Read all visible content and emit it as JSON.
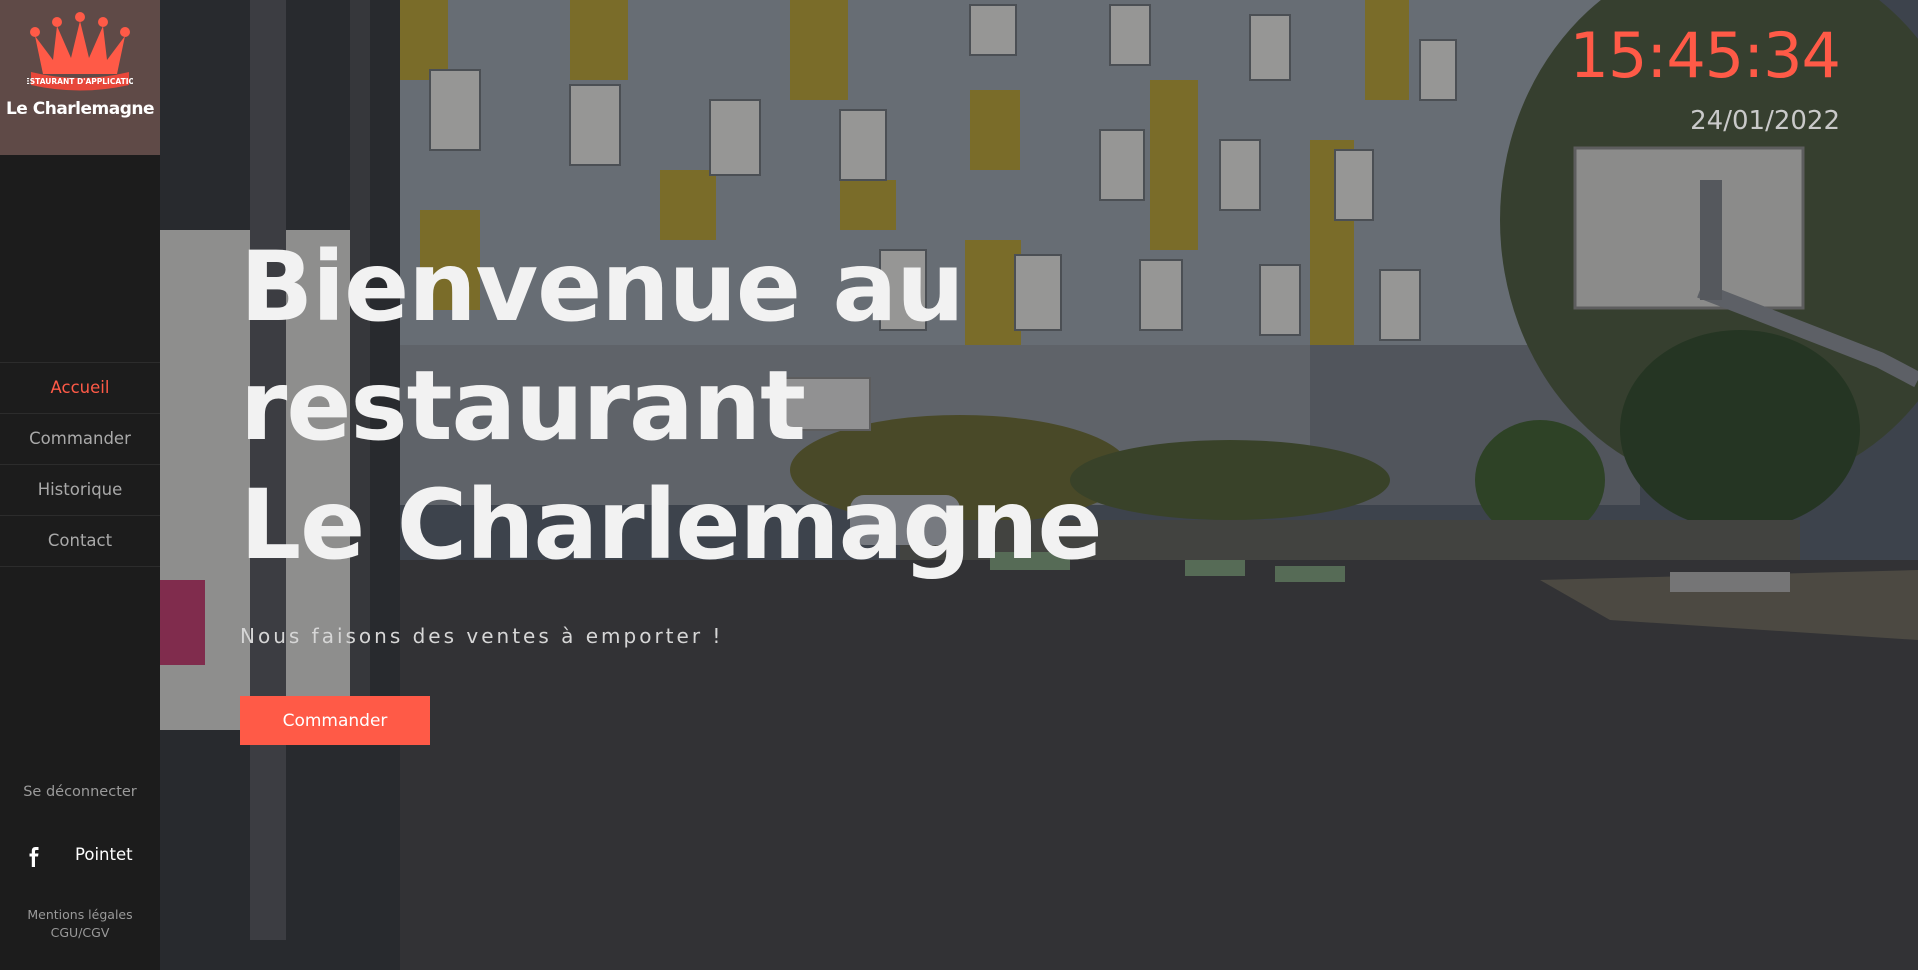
{
  "brand": {
    "name": "Le Charlemagne",
    "logo_ribbon": "RESTAURANT D'APPLICATION",
    "accent_color": "#ff5a47",
    "logo_bg": "#5f4a47"
  },
  "nav": {
    "items": [
      {
        "label": "Accueil",
        "active": true
      },
      {
        "label": "Commander",
        "active": false
      },
      {
        "label": "Historique",
        "active": false
      },
      {
        "label": "Contact",
        "active": false
      }
    ]
  },
  "sidebar_footer": {
    "logout_label": "Se déconnecter",
    "social": {
      "icon": "facebook-icon",
      "label": "Pointet"
    },
    "legal_links": [
      "Mentions légales",
      "CGU/CGV"
    ]
  },
  "header": {
    "time": "15:45:34",
    "date": "24/01/2022"
  },
  "hero": {
    "title_lines": [
      "Bienvenue au",
      "restaurant",
      "Le Charlemagne"
    ],
    "subtitle": "Nous faisons des ventes à emporter !",
    "cta_label": "Commander"
  }
}
